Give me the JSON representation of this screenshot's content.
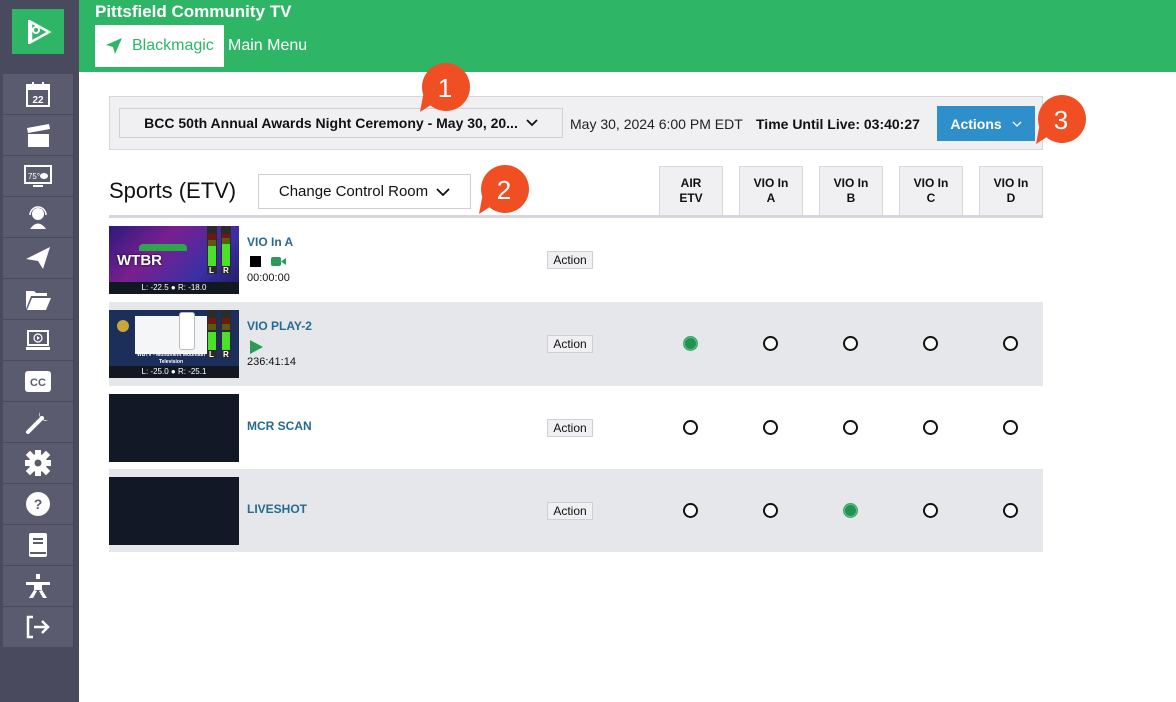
{
  "header": {
    "station_name": "Pittsfield Community TV",
    "room_button_label": "Blackmagic",
    "main_menu_label": "Main Menu"
  },
  "sidebar": {
    "items": [
      {
        "name": "schedule",
        "icon": "calendar-icon",
        "label": "22"
      },
      {
        "name": "productions",
        "icon": "clapperboard-icon"
      },
      {
        "name": "weather",
        "icon": "weather-display-icon",
        "label": "75°"
      },
      {
        "name": "operators",
        "icon": "headset-icon"
      },
      {
        "name": "send",
        "icon": "paper-plane-icon"
      },
      {
        "name": "files",
        "icon": "folder-open-icon"
      },
      {
        "name": "video-playback",
        "icon": "laptop-play-icon"
      },
      {
        "name": "captions",
        "icon": "closed-captions-icon",
        "label": "CC"
      },
      {
        "name": "tools",
        "icon": "wrench-icon"
      },
      {
        "name": "settings",
        "icon": "gear-icon"
      },
      {
        "name": "help",
        "icon": "question-circle-icon",
        "label": "?"
      },
      {
        "name": "manual",
        "icon": "book-icon"
      },
      {
        "name": "accessibility",
        "icon": "person-icon"
      },
      {
        "name": "logout",
        "icon": "logout-icon"
      }
    ]
  },
  "event_bar": {
    "event_select_value": "BCC 50th Annual Awards Night Ceremony - May 30, 20...",
    "event_date": "May 30, 2024 6:00 PM EDT",
    "time_until_live_label": "Time Until Live:",
    "time_until_live_value": "03:40:27",
    "actions_label": "Actions"
  },
  "control_room": {
    "title": "Sports (ETV)",
    "change_room_label": "Change Control Room",
    "columns": [
      {
        "line1": "AIR",
        "line2": "ETV"
      },
      {
        "line1": "VIO In",
        "line2": "A"
      },
      {
        "line1": "VIO In",
        "line2": "B"
      },
      {
        "line1": "VIO In",
        "line2": "C"
      },
      {
        "line1": "VIO In",
        "line2": "D"
      }
    ],
    "sources": [
      {
        "name": "VIO In A",
        "status": "stopped",
        "timecode": "00:00:00",
        "audio_l": "L: -22.5",
        "audio_r": "R: -18.0",
        "thumb_label": "WTBR",
        "action_label": "Action",
        "routes": null
      },
      {
        "name": "VIO PLAY-2",
        "status": "playing",
        "timecode": "236:41:14",
        "audio_l": "L: -25.0",
        "audio_r": "R: -25.1",
        "thumb_label": "WBTV - Monument Mountain Television",
        "action_label": "Action",
        "routes": [
          true,
          false,
          false,
          false,
          false
        ]
      },
      {
        "name": "MCR SCAN",
        "status": "",
        "timecode": "",
        "action_label": "Action",
        "routes": [
          false,
          false,
          false,
          false,
          false
        ]
      },
      {
        "name": "LIVESHOT",
        "status": "",
        "timecode": "",
        "action_label": "Action",
        "routes": [
          false,
          false,
          true,
          false,
          false
        ]
      }
    ],
    "meter_labels": {
      "left": "L",
      "right": "R"
    }
  },
  "annotations": [
    {
      "number": "1"
    },
    {
      "number": "2"
    },
    {
      "number": "3"
    }
  ],
  "colors": {
    "brand_green": "#2fb566",
    "sidebar_bg": "#4a4a5e",
    "actions_blue": "#2e8fca",
    "link_blue": "#276a8f",
    "badge_orange": "#f04e23",
    "active_route": "#23914f"
  }
}
